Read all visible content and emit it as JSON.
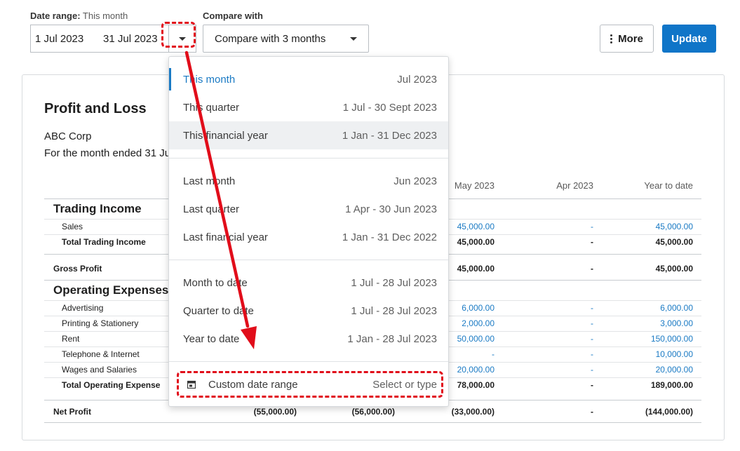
{
  "toolbar": {
    "date_range_label": "Date range:",
    "date_range_value": "This month",
    "start_date": "1 Jul 2023",
    "end_date": "31 Jul 2023",
    "compare_label": "Compare with",
    "compare_value": "Compare with 3 months",
    "more_label": "More",
    "update_label": "Update"
  },
  "report": {
    "title": "Profit and Loss",
    "company": "ABC Corp",
    "period": "For the month ended 31 Ju",
    "columns": [
      "May 2023",
      "Apr 2023",
      "Year to date"
    ],
    "sections": {
      "trading": "Trading Income",
      "operating": "Operating Expenses"
    },
    "rows": {
      "sales": {
        "label": "Sales",
        "may": "45,000.00",
        "apr": "-",
        "ytd": "45,000.00"
      },
      "total_trading": {
        "label": "Total Trading Income",
        "may": "45,000.00",
        "apr": "-",
        "ytd": "45,000.00"
      },
      "gross_profit": {
        "label": "Gross Profit",
        "may": "45,000.00",
        "apr": "-",
        "ytd": "45,000.00"
      },
      "advertising": {
        "label": "Advertising",
        "may": "6,000.00",
        "apr": "-",
        "ytd": "6,000.00"
      },
      "printing": {
        "label": "Printing & Stationery",
        "may": "2,000.00",
        "apr": "-",
        "ytd": "3,000.00"
      },
      "rent": {
        "label": "Rent",
        "may": "50,000.00",
        "apr": "-",
        "ytd": "150,000.00"
      },
      "telephone": {
        "label": "Telephone & Internet",
        "may": "-",
        "apr": "-",
        "ytd": "10,000.00"
      },
      "wages": {
        "label": "Wages and Salaries",
        "may": "20,000.00",
        "apr": "-",
        "ytd": "20,000.00"
      },
      "total_operating": {
        "label": "Total Operating Expense",
        "may": "78,000.00",
        "apr": "-",
        "ytd": "189,000.00"
      },
      "net_profit": {
        "label": "Net Profit",
        "c1": "(55,000.00)",
        "c2": "(56,000.00)",
        "may": "(33,000.00)",
        "apr": "-",
        "ytd": "(144,000.00)"
      }
    }
  },
  "dropdown": {
    "options": [
      {
        "label": "This month",
        "value": "Jul 2023"
      },
      {
        "label": "This quarter",
        "value": "1 Jul - 30 Sept 2023"
      },
      {
        "label": "This financial year",
        "value": "1 Jan - 31 Dec 2023"
      },
      {
        "label": "Last month",
        "value": "Jun 2023"
      },
      {
        "label": "Last quarter",
        "value": "1 Apr - 30 Jun 2023"
      },
      {
        "label": "Last financial year",
        "value": "1 Jan - 31 Dec 2022"
      },
      {
        "label": "Month to date",
        "value": "1 Jul - 28 Jul 2023"
      },
      {
        "label": "Quarter to date",
        "value": "1 Jul - 28 Jul 2023"
      },
      {
        "label": "Year to date",
        "value": "1 Jan - 28 Jul 2023"
      }
    ],
    "custom": {
      "label": "Custom date range",
      "hint": "Select or type"
    }
  },
  "colors": {
    "accent": "#1a7ac4",
    "update_button": "#0f75c8",
    "annotation": "#e10d1a"
  },
  "icons": [
    "chevron-down-icon",
    "more-dots-icon",
    "calendar-icon",
    "annotation-arrow"
  ]
}
